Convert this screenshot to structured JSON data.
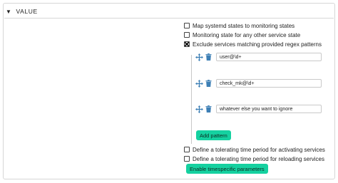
{
  "section": {
    "title": "VALUE"
  },
  "options": {
    "map_states": {
      "label": "Map systemd states to monitoring states",
      "checked": false
    },
    "other_state": {
      "label": "Monitoring state for any other service state",
      "checked": false
    },
    "exclude": {
      "label": "Exclude services matching provided regex patterns",
      "checked": true
    }
  },
  "patterns": [
    {
      "value": "user@\\d+"
    },
    {
      "value": "check_mk@\\d+"
    },
    {
      "value": "whatever else you want to ignore"
    }
  ],
  "add_pattern_label": "Add pattern",
  "tolerating": {
    "activating": {
      "label": "Define a tolerating time period for activating services",
      "checked": false
    },
    "reloading": {
      "label": "Define a tolerating time period for reloading services",
      "checked": false
    }
  },
  "enable_timespecific_label": "Enable timespecific parameters",
  "icons": {
    "move": "move-arrows-icon",
    "delete": "trash-icon",
    "collapse": "triangle-down-icon"
  },
  "colors": {
    "accent": "#15d1a0",
    "icon_blue": "#3d7fb5"
  }
}
